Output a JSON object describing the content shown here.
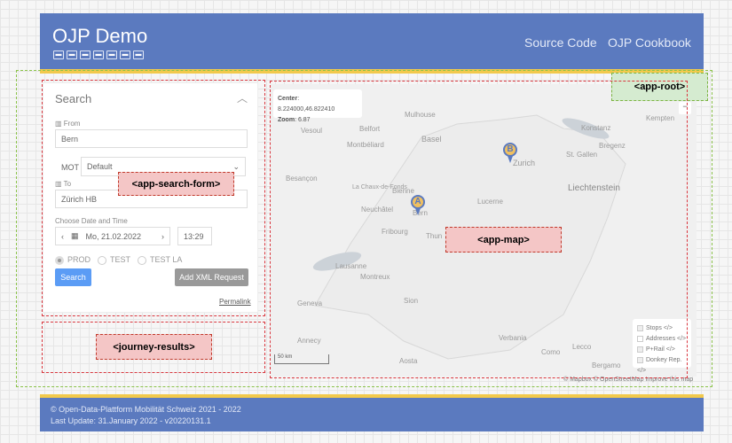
{
  "header": {
    "title": "OJP Demo",
    "modes": [
      "bus-icon",
      "tram-icon",
      "train-icon",
      "funicular-icon",
      "cablecar-icon",
      "rack-railway-icon",
      "boat-icon"
    ],
    "links": [
      "Source Code",
      "OJP Cookbook"
    ]
  },
  "search": {
    "title": "Search",
    "from_label": "From",
    "from_value": "Bern",
    "mot_label": "MOT",
    "mot_value": "Default",
    "to_label": "To",
    "to_value": "Zürich HB",
    "datetime_label": "Choose Date and Time",
    "date": "Mo, 21.02.2022",
    "time": "13:29",
    "envs": [
      {
        "label": "PROD",
        "selected": true
      },
      {
        "label": "TEST",
        "selected": false
      },
      {
        "label": "TEST LA",
        "selected": false
      }
    ],
    "search_button": "Search",
    "xml_button": "Add XML Request",
    "permalink": "Permalink"
  },
  "map": {
    "center_label": "Center",
    "center_value": "8.224000,46.822410",
    "zoom_label": "Zoom",
    "zoom_value": "6.87",
    "scale": "50 km",
    "attribution": "© Mapbox © OpenStreetMap Improve this map",
    "markers": [
      "A",
      "B"
    ],
    "cities": [
      "Mulhouse",
      "Vesoul",
      "Belfort",
      "Basel",
      "Montbéliard",
      "Besançon",
      "Zurich",
      "Konstanz",
      "St. Gallen",
      "Bregenz",
      "Kempten",
      "Liechtenstein",
      "La Chaux-de-Fonds",
      "Bienne",
      "Lucerne",
      "Neuchâtel",
      "Bern",
      "Fribourg",
      "Thun",
      "Lausanne",
      "Montreux",
      "Geneva",
      "Sion",
      "Annecy",
      "Verbania",
      "Como",
      "Lecco",
      "Aosta",
      "Bergamo"
    ],
    "layers": [
      {
        "label": "Stops </>",
        "checked": true
      },
      {
        "label": "Addresses </>",
        "checked": false
      },
      {
        "label": "P+Rail </>",
        "checked": true
      },
      {
        "label": "Donkey Rep. </>",
        "checked": true
      }
    ]
  },
  "footer": {
    "line1": "© Open-Data-Plattform Mobilität Schweiz 2021 - 2022",
    "line2": "Last Update: 31.January 2022 - v20220131.1"
  },
  "annotations": {
    "root": "<app-root>",
    "search_form": "<app-search-form>",
    "journey_results": "<journey-results>",
    "map": "<app-map>"
  },
  "colors": {
    "header": "#5b7abf",
    "accent": "#f2c94c",
    "primary_button": "#5b9cf5"
  }
}
